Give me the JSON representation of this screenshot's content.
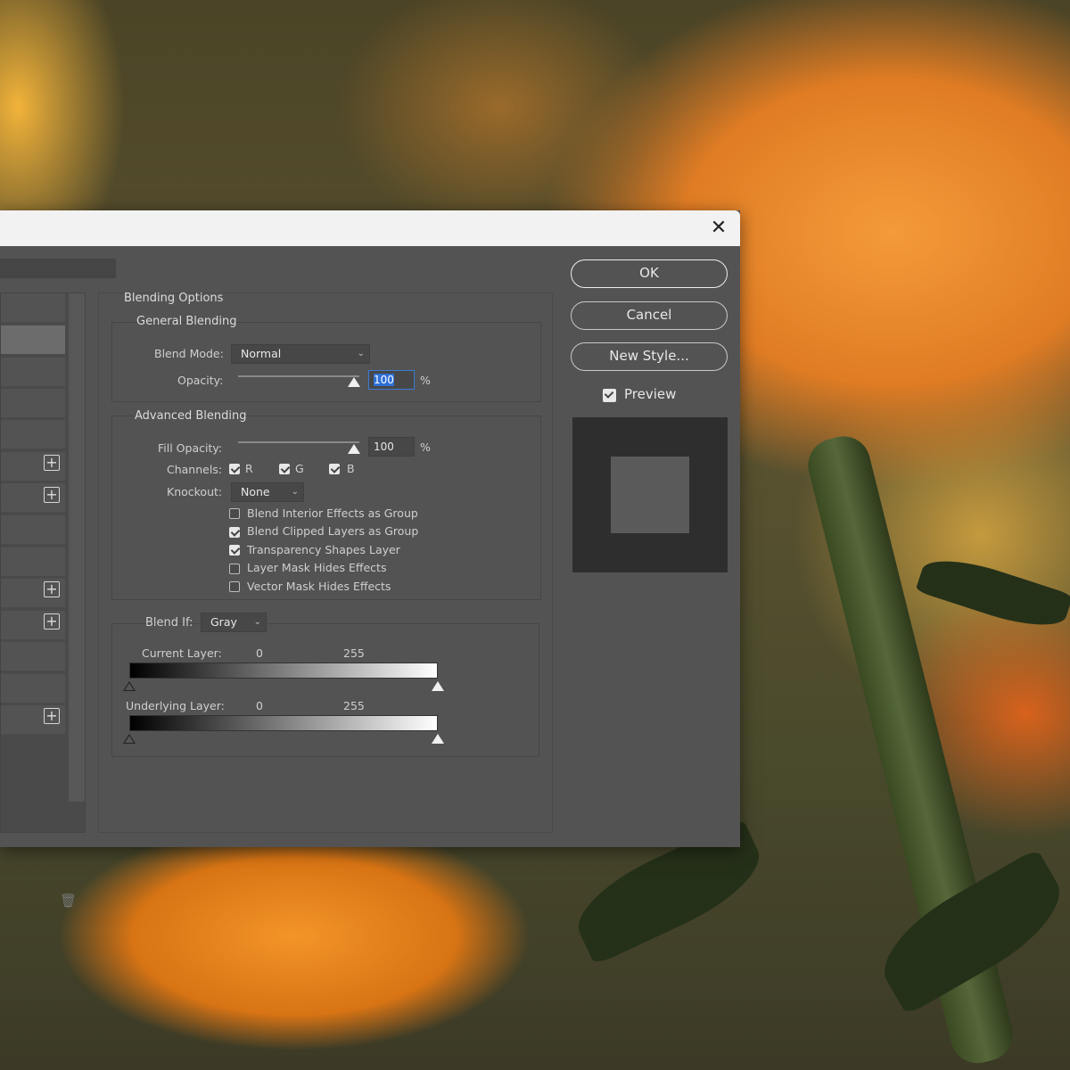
{
  "dialog": {
    "close_glyph": "✕",
    "buttons": {
      "ok": "OK",
      "cancel": "Cancel",
      "new_style": "New Style..."
    },
    "preview": {
      "label": "Preview",
      "checked": true
    }
  },
  "blending_options": {
    "title": "Blending Options",
    "general": {
      "title": "General Blending",
      "blend_mode_label": "Blend Mode:",
      "blend_mode_value": "Normal",
      "opacity_label": "Opacity:",
      "opacity_value": "100",
      "percent": "%"
    },
    "advanced": {
      "title": "Advanced Blending",
      "fill_opacity_label": "Fill Opacity:",
      "fill_opacity_value": "100",
      "percent": "%",
      "channels_label": "Channels:",
      "channels": [
        {
          "label": "R",
          "checked": true
        },
        {
          "label": "G",
          "checked": true
        },
        {
          "label": "B",
          "checked": true
        }
      ],
      "knockout_label": "Knockout:",
      "knockout_value": "None",
      "options": [
        {
          "label": "Blend Interior Effects as Group",
          "checked": false
        },
        {
          "label": "Blend Clipped Layers as Group",
          "checked": true
        },
        {
          "label": "Transparency Shapes Layer",
          "checked": true
        },
        {
          "label": "Layer Mask Hides Effects",
          "checked": false
        },
        {
          "label": "Vector Mask Hides Effects",
          "checked": false
        }
      ]
    },
    "blend_if": {
      "label": "Blend If:",
      "value": "Gray",
      "current_layer": {
        "label": "Current Layer:",
        "min": "0",
        "max": "255"
      },
      "underlying_layer": {
        "label": "Underlying Layer:",
        "min": "0",
        "max": "255"
      }
    }
  },
  "icons": {
    "close": "close-icon",
    "chevron": "chevron-down-icon",
    "plus": "plus-icon",
    "trash": "trash-icon"
  }
}
